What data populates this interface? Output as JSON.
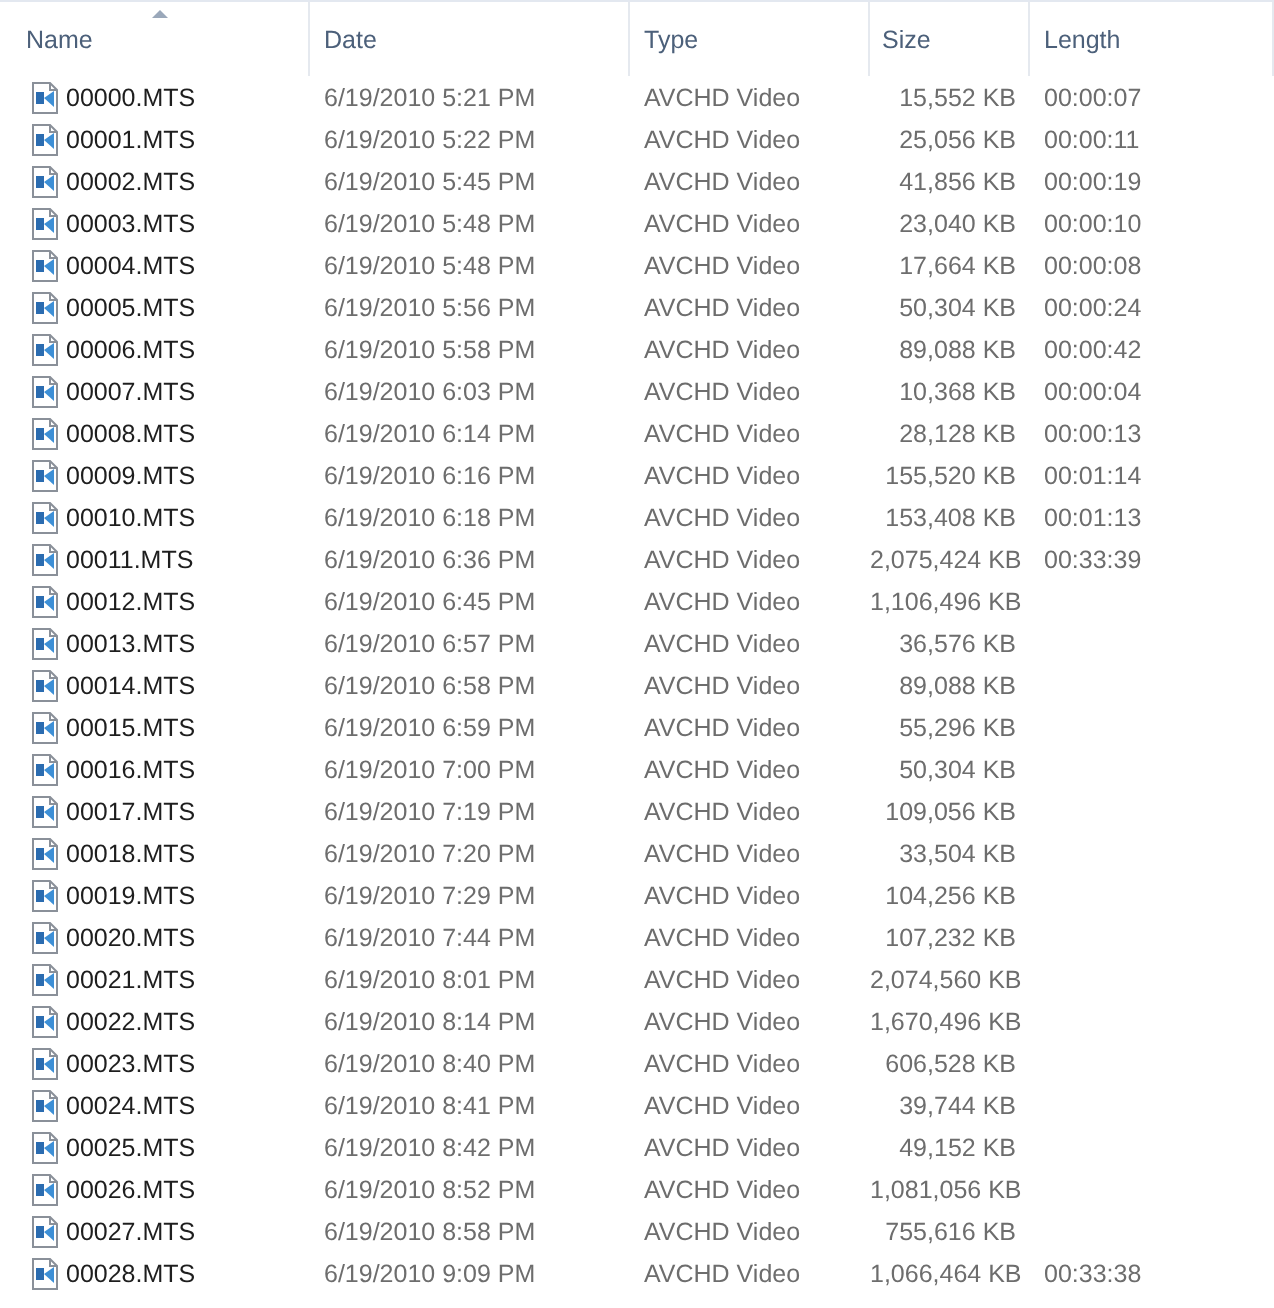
{
  "columns": [
    {
      "label": "Name",
      "sorted": true
    },
    {
      "label": "Date",
      "sorted": false
    },
    {
      "label": "Type",
      "sorted": false
    },
    {
      "label": "Size",
      "sorted": false
    },
    {
      "label": "Length",
      "sorted": false
    }
  ],
  "rows": [
    {
      "name": "00000.MTS",
      "date": "6/19/2010 5:21 PM",
      "type": "AVCHD Video",
      "size": "15,552 KB",
      "length": "00:00:07"
    },
    {
      "name": "00001.MTS",
      "date": "6/19/2010 5:22 PM",
      "type": "AVCHD Video",
      "size": "25,056 KB",
      "length": "00:00:11"
    },
    {
      "name": "00002.MTS",
      "date": "6/19/2010 5:45 PM",
      "type": "AVCHD Video",
      "size": "41,856 KB",
      "length": "00:00:19"
    },
    {
      "name": "00003.MTS",
      "date": "6/19/2010 5:48 PM",
      "type": "AVCHD Video",
      "size": "23,040 KB",
      "length": "00:00:10"
    },
    {
      "name": "00004.MTS",
      "date": "6/19/2010 5:48 PM",
      "type": "AVCHD Video",
      "size": "17,664 KB",
      "length": "00:00:08"
    },
    {
      "name": "00005.MTS",
      "date": "6/19/2010 5:56 PM",
      "type": "AVCHD Video",
      "size": "50,304 KB",
      "length": "00:00:24"
    },
    {
      "name": "00006.MTS",
      "date": "6/19/2010 5:58 PM",
      "type": "AVCHD Video",
      "size": "89,088 KB",
      "length": "00:00:42"
    },
    {
      "name": "00007.MTS",
      "date": "6/19/2010 6:03 PM",
      "type": "AVCHD Video",
      "size": "10,368 KB",
      "length": "00:00:04"
    },
    {
      "name": "00008.MTS",
      "date": "6/19/2010 6:14 PM",
      "type": "AVCHD Video",
      "size": "28,128 KB",
      "length": "00:00:13"
    },
    {
      "name": "00009.MTS",
      "date": "6/19/2010 6:16 PM",
      "type": "AVCHD Video",
      "size": "155,520 KB",
      "length": "00:01:14"
    },
    {
      "name": "00010.MTS",
      "date": "6/19/2010 6:18 PM",
      "type": "AVCHD Video",
      "size": "153,408 KB",
      "length": "00:01:13"
    },
    {
      "name": "00011.MTS",
      "date": "6/19/2010 6:36 PM",
      "type": "AVCHD Video",
      "size": "2,075,424 KB",
      "length": "00:33:39"
    },
    {
      "name": "00012.MTS",
      "date": "6/19/2010 6:45 PM",
      "type": "AVCHD Video",
      "size": "1,106,496 KB"
    },
    {
      "name": "00013.MTS",
      "date": "6/19/2010 6:57 PM",
      "type": "AVCHD Video",
      "size": "36,576 KB"
    },
    {
      "name": "00014.MTS",
      "date": "6/19/2010 6:58 PM",
      "type": "AVCHD Video",
      "size": "89,088 KB"
    },
    {
      "name": "00015.MTS",
      "date": "6/19/2010 6:59 PM",
      "type": "AVCHD Video",
      "size": "55,296 KB"
    },
    {
      "name": "00016.MTS",
      "date": "6/19/2010 7:00 PM",
      "type": "AVCHD Video",
      "size": "50,304 KB"
    },
    {
      "name": "00017.MTS",
      "date": "6/19/2010 7:19 PM",
      "type": "AVCHD Video",
      "size": "109,056 KB"
    },
    {
      "name": "00018.MTS",
      "date": "6/19/2010 7:20 PM",
      "type": "AVCHD Video",
      "size": "33,504 KB"
    },
    {
      "name": "00019.MTS",
      "date": "6/19/2010 7:29 PM",
      "type": "AVCHD Video",
      "size": "104,256 KB"
    },
    {
      "name": "00020.MTS",
      "date": "6/19/2010 7:44 PM",
      "type": "AVCHD Video",
      "size": "107,232 KB"
    },
    {
      "name": "00021.MTS",
      "date": "6/19/2010 8:01 PM",
      "type": "AVCHD Video",
      "size": "2,074,560 KB"
    },
    {
      "name": "00022.MTS",
      "date": "6/19/2010 8:14 PM",
      "type": "AVCHD Video",
      "size": "1,670,496 KB"
    },
    {
      "name": "00023.MTS",
      "date": "6/19/2010 8:40 PM",
      "type": "AVCHD Video",
      "size": "606,528 KB"
    },
    {
      "name": "00024.MTS",
      "date": "6/19/2010 8:41 PM",
      "type": "AVCHD Video",
      "size": "39,744 KB"
    },
    {
      "name": "00025.MTS",
      "date": "6/19/2010 8:42 PM",
      "type": "AVCHD Video",
      "size": "49,152 KB"
    },
    {
      "name": "00026.MTS",
      "date": "6/19/2010 8:52 PM",
      "type": "AVCHD Video",
      "size": "1,081,056 KB"
    },
    {
      "name": "00027.MTS",
      "date": "6/19/2010 8:58 PM",
      "type": "AVCHD Video",
      "size": "755,616 KB"
    },
    {
      "name": "00028.MTS",
      "date": "6/19/2010 9:09 PM",
      "type": "AVCHD Video",
      "size": "1,066,464 KB",
      "length": "00:33:38"
    }
  ]
}
